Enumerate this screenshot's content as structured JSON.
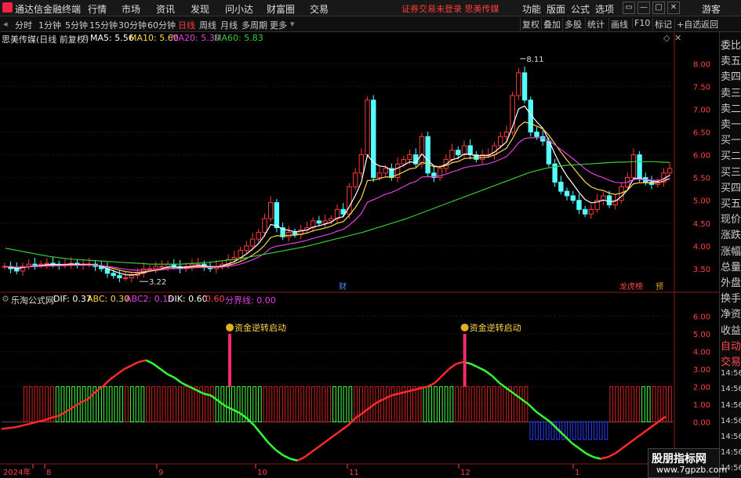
{
  "app": {
    "name": "通达信金融终端",
    "menu": [
      "行情",
      "市场",
      "资讯",
      "发现",
      "问小达",
      "财富圈",
      "交易"
    ],
    "warning": "证券交易未登录  思美传媒",
    "right_menu": [
      "功能",
      "版面",
      "公式",
      "选项"
    ],
    "guest": "游客",
    "window_buttons": [
      "▭",
      "—",
      "□",
      "✕"
    ]
  },
  "toolbar": {
    "periods": [
      "分时",
      "1分钟",
      "5分钟",
      "15分钟",
      "30分钟",
      "60分钟",
      "日线",
      "周线",
      "月线",
      "多周期",
      "更多"
    ],
    "active_period": "日线",
    "right_buttons": [
      "复权",
      "叠加",
      "多股",
      "统计",
      "画线",
      "F10",
      "标记",
      "+自选",
      "返回"
    ]
  },
  "main_chart": {
    "title": "思美传媒(日线 前复权)",
    "ma": [
      {
        "label": "MA5: 5.56",
        "color": "#ffffff"
      },
      {
        "label": "MA10: 5.60",
        "color": "#ffd84a"
      },
      {
        "label": "MA20: 5.30",
        "color": "#e040e0"
      },
      {
        "label": "MA60: 5.83",
        "color": "#33cc33"
      }
    ],
    "high_label": "8.11",
    "low_label": "3.22",
    "event_labels": [
      {
        "text": "财",
        "color": "#4a8cff"
      },
      {
        "text": "龙虎榜",
        "color": "#ff4444"
      },
      {
        "text": "预",
        "color": "#e0a020"
      }
    ]
  },
  "indicator": {
    "name": "乐淘公式网",
    "values": [
      {
        "label": "DIF: 0.37",
        "color": "#ffffff"
      },
      {
        "label": "ABC: 0.30",
        "color": "#ffd84a"
      },
      {
        "label": "ABC2: 0.15",
        "color": "#e040e0"
      },
      {
        "label": "DIK: 0.60",
        "color": "#ffffff"
      },
      {
        "label": "0.60",
        "color": "#ff4444"
      },
      {
        "label": "分界线: 0.00",
        "color": "#e040e0"
      }
    ],
    "signal_label": "资金逆转启动"
  },
  "right_panel": {
    "items": [
      "委比",
      "卖五",
      "卖四",
      "卖三",
      "卖二",
      "卖一",
      "买一",
      "买二",
      "买三",
      "买四",
      "买五",
      "现价",
      "涨跌",
      "涨幅",
      "总量",
      "外盘",
      "换手",
      "净资",
      "收益",
      "自动",
      "交易",
      "14:56",
      "14:56",
      "14:56",
      "14:56",
      "14:56",
      "14:56",
      "14:56"
    ]
  },
  "x_axis": {
    "labels": [
      "2024年",
      "8",
      "9",
      "10",
      "11",
      "12",
      "1"
    ]
  },
  "chart_data": {
    "type": "candlestick",
    "price_axis": {
      "ticks": [
        3.5,
        4.0,
        4.5,
        5.0,
        5.5,
        6.0,
        6.5,
        7.0,
        7.5,
        8.0
      ],
      "ylim": [
        3.0,
        8.4
      ]
    },
    "indicator_axis": {
      "ticks": [
        0.0,
        1.0,
        2.0,
        3.0,
        4.0,
        5.0,
        6.0
      ],
      "ylim": [
        -2.3,
        6.6
      ]
    },
    "closes": [
      3.55,
      3.5,
      3.45,
      3.55,
      3.6,
      3.58,
      3.6,
      3.62,
      3.6,
      3.58,
      3.6,
      3.62,
      3.58,
      3.6,
      3.6,
      3.55,
      3.5,
      3.4,
      3.35,
      3.3,
      3.3,
      3.35,
      3.4,
      3.5,
      3.5,
      3.55,
      3.55,
      3.6,
      3.55,
      3.5,
      3.55,
      3.6,
      3.6,
      3.55,
      3.5,
      3.55,
      3.6,
      3.7,
      3.75,
      3.9,
      4.0,
      4.15,
      4.3,
      4.6,
      4.95,
      4.4,
      4.2,
      4.3,
      4.25,
      4.35,
      4.4,
      4.55,
      4.5,
      4.55,
      4.6,
      4.8,
      4.7,
      5.3,
      5.6,
      6.0,
      7.2,
      5.5,
      5.6,
      5.7,
      5.5,
      5.8,
      5.9,
      6.0,
      5.8,
      6.4,
      5.6,
      5.5,
      5.7,
      5.9,
      6.1,
      6.0,
      6.2,
      6.0,
      5.9,
      6.0,
      6.0,
      6.2,
      6.4,
      6.5,
      7.3,
      7.8,
      7.2,
      6.5,
      6.4,
      6.3,
      5.8,
      5.4,
      5.2,
      5.1,
      5.0,
      4.8,
      4.7,
      4.8,
      5.0,
      5.1,
      4.9,
      5.0,
      5.3,
      5.5,
      6.0,
      5.5,
      5.4,
      5.35,
      5.4,
      5.6,
      5.7
    ],
    "ma60": [
      3.95,
      3.92,
      3.89,
      3.86,
      3.83,
      3.8,
      3.77,
      3.75,
      3.73,
      3.71,
      3.7,
      3.69,
      3.68,
      3.67,
      3.66,
      3.65,
      3.64,
      3.63,
      3.62,
      3.61,
      3.6,
      3.6,
      3.6,
      3.6,
      3.6,
      3.61,
      3.62,
      3.63,
      3.64,
      3.66,
      3.68,
      3.7,
      3.72,
      3.74,
      3.77,
      3.8,
      3.83,
      3.86,
      3.89,
      3.92,
      3.95,
      3.98,
      4.02,
      4.06,
      4.1,
      4.14,
      4.18,
      4.22,
      4.26,
      4.3,
      4.35,
      4.4,
      4.45,
      4.5,
      4.55,
      4.6,
      4.66,
      4.72,
      4.78,
      4.84,
      4.9,
      4.96,
      5.02,
      5.08,
      5.14,
      5.2,
      5.26,
      5.32,
      5.38,
      5.44,
      5.5,
      5.56,
      5.62,
      5.66,
      5.7,
      5.73,
      5.75,
      5.77,
      5.78,
      5.79,
      5.8,
      5.81,
      5.82,
      5.83,
      5.84,
      5.84,
      5.85,
      5.85,
      5.85,
      5.85,
      5.84,
      5.83
    ],
    "dif": [
      -0.4,
      -0.35,
      -0.3,
      -0.2,
      -0.1,
      0.0,
      0.1,
      0.25,
      0.35,
      0.6,
      0.85,
      1.1,
      1.3,
      1.7,
      2.0,
      2.4,
      2.7,
      3.0,
      3.2,
      3.4,
      3.5,
      3.3,
      3.0,
      2.7,
      2.5,
      2.2,
      2.0,
      1.8,
      1.6,
      1.5,
      1.2,
      0.9,
      0.7,
      0.5,
      0.2,
      -0.2,
      -0.7,
      -1.2,
      -1.6,
      -1.9,
      -2.1,
      -2.2,
      -2.0,
      -1.7,
      -1.4,
      -1.1,
      -0.8,
      -0.5,
      -0.2,
      0.2,
      0.5,
      0.8,
      1.1,
      1.3,
      1.5,
      1.6,
      1.7,
      1.8,
      1.9,
      2.0,
      2.2,
      2.6,
      3.0,
      3.3,
      3.4,
      3.3,
      3.1,
      2.9,
      2.6,
      2.2,
      1.9,
      1.6,
      1.3,
      1.0,
      0.6,
      0.3,
      0.0,
      -0.4,
      -0.8,
      -1.2,
      -1.5,
      -1.8,
      -2.0,
      -2.1,
      -2.0,
      -1.8,
      -1.5,
      -1.2,
      -0.9,
      -0.6,
      -0.3,
      0.0,
      0.3
    ],
    "bars": "0000RRRRRRGGGGGGGGGGGGGRGGGRRRRRRRRRRRRRGGGGGGGGGRRRRRRRRRRRRRGGGGRRRRRRRRRRRRRGGGGGGRRRRRRRRRRRRRRBBBBBBBBBBBBBBBRRRRRRGGRRRR",
    "signals": [
      {
        "x_frac": 0.34,
        "value": 5.0
      },
      {
        "x_frac": 0.69,
        "value": 5.0
      }
    ]
  }
}
